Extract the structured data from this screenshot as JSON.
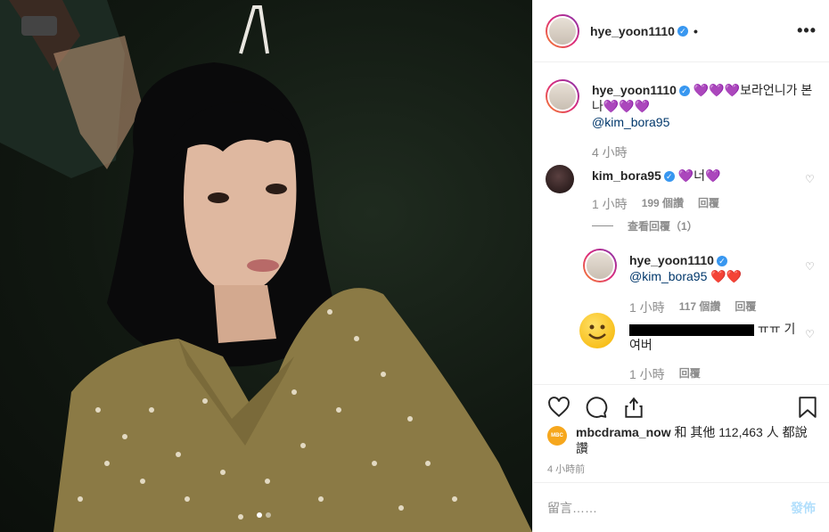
{
  "post": {
    "author": "hye_yoon1110",
    "follow_bullet": "•",
    "more_glyph": "•••",
    "verified_glyph": "✓",
    "photo_dots": 2,
    "active_dot": 0
  },
  "caption": {
    "author": "hye_yoon1110",
    "text": "💜💜💜보라언니가 본나💜💜💜",
    "mention": "@kim_bora95",
    "time": "4 小時"
  },
  "comments": [
    {
      "author": "kim_bora95",
      "text": "💜너💜",
      "time": "1 小時",
      "likes": "199 個讚",
      "reply": "回覆",
      "view_replies": "查看回覆（1）"
    },
    {
      "author": "hye_yoon1110",
      "mention": "@kim_bora95",
      "text": "❤️❤️",
      "time": "1 小時",
      "likes": "117 個讚",
      "reply": "回覆"
    },
    {
      "text_suffix": "ㅠㅠ 기여버",
      "time": "1 小時",
      "reply": "回覆"
    }
  ],
  "likes": {
    "avatar_text": "MBC DRAMA",
    "user": "mbcdrama_now",
    "text": " 和 其他 112,463 人 都說讚"
  },
  "time_ago": "4 小時前",
  "add_comment": {
    "placeholder": "留言……",
    "post_label": "發佈"
  },
  "colors": {
    "verified": "#3897f0",
    "post_disabled": "#b2dffc",
    "heart_purple": "#9b59d0",
    "dress_olive": "#8b7a45"
  },
  "icons": [
    "heart-icon",
    "comment-icon",
    "share-icon",
    "bookmark-icon",
    "more-icon",
    "verified-icon"
  ]
}
